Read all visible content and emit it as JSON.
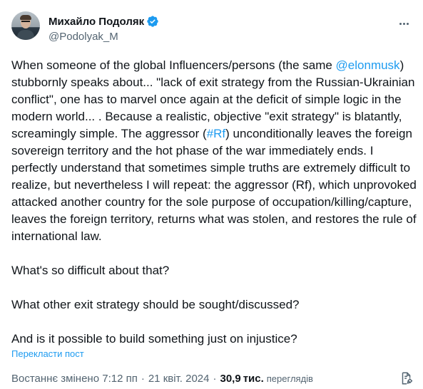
{
  "author": {
    "display_name": "Михайло Подоляк",
    "handle": "@Podolyak_M",
    "verified": true
  },
  "tweet": {
    "paragraphs": [
      [
        {
          "text": "When someone of the global Influencers/persons (the same ",
          "link": false
        },
        {
          "text": "@elonmusk",
          "link": true
        },
        {
          "text": ") stubbornly speaks about... \"lack of exit strategy from the Russian-Ukrainian conflict\", one has to marvel once again at the deficit of simple logic in the modern world... . Because a realistic, objective \"exit strategy\" is blatantly, screamingly simple. The aggressor (",
          "link": false
        },
        {
          "text": "#Rf",
          "link": true
        },
        {
          "text": ") unconditionally leaves the foreign sovereign territory and the hot phase of the war immediately ends. I perfectly understand that sometimes simple truths are extremely difficult to realize, but nevertheless I will repeat: the aggressor (Rf), which unprovoked attacked another country for the sole purpose of occupation/killing/capture, leaves the foreign territory, returns what was stolen, and restores the rule of international law.",
          "link": false
        }
      ],
      [
        {
          "text": "What's so difficult about that?",
          "link": false
        }
      ],
      [
        {
          "text": "What other exit strategy should be sought/discussed?",
          "link": false
        }
      ],
      [
        {
          "text": "And is it possible to build something just on injustice?",
          "link": false
        }
      ]
    ]
  },
  "translate_label": "Перекласти пост",
  "meta": {
    "edited_label": "Востаннє змінено 7:12 пп",
    "separator": "·",
    "date": "21 квіт. 2024",
    "views_count": "30,9",
    "views_unit": "тис.",
    "views_label": "переглядів"
  },
  "icons": {
    "verified": "verified-badge-icon",
    "more": "more-options-icon",
    "edit_history": "edit-history-icon"
  },
  "colors": {
    "link": "#1d9bf0",
    "text": "#0f1419",
    "secondary": "#536471"
  }
}
